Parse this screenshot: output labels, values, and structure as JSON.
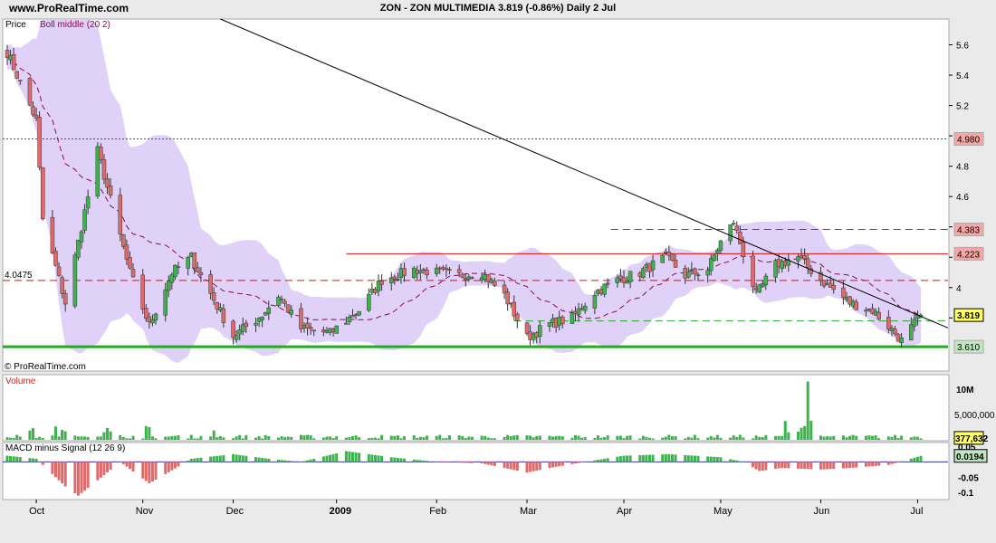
{
  "header": {
    "site": "www.ProRealTime.com",
    "title": "ZON - ZON MULTIMEDIA   3.819 (-0.86%)   Daily  2 Jul"
  },
  "colors": {
    "background": "#ffffff",
    "band": "#d9c9f7",
    "up": "#3cb44b",
    "down": "#e06a6a",
    "candle_outline": "#333333",
    "boll_middle": "#8b0a50",
    "support": "#22aa22",
    "resistance_red": "#dd1111"
  },
  "chart_data": [
    {
      "type": "candlestick",
      "panel": "price",
      "legend": [
        "Price",
        "Boll middle (20 2)"
      ],
      "y_ticks": [
        5.6,
        5.4,
        5.2,
        5,
        4.8,
        4.6,
        4.4,
        4.2,
        4,
        3.8
      ],
      "ylim": [
        3.45,
        5.77
      ],
      "x_ticks": [
        "Oct",
        "Nov",
        "Dec",
        "2009",
        "Feb",
        "Mar",
        "Apr",
        "May",
        "Jun",
        "Jul"
      ],
      "left_label": "4.0475",
      "price_labels": [
        "4.980",
        "4.383",
        "4.223",
        "3.819",
        "3.610"
      ],
      "horizontal_lines": [
        {
          "value": 4.98,
          "style": "dotted",
          "label": "4.980"
        },
        {
          "value": 4.383,
          "style": "dashed",
          "label": "4.383"
        },
        {
          "value": 4.223,
          "style": "solid",
          "label": "4.223"
        },
        {
          "value": 4.0475,
          "style": "dashed",
          "label": "4.0475"
        },
        {
          "value": 3.78,
          "style": "dashed-green",
          "label": ""
        },
        {
          "value": 3.61,
          "style": "solid-green",
          "label": "3.610"
        }
      ],
      "trendline": {
        "start": {
          "date": "Nov 27",
          "value": 5.77
        },
        "end": {
          "date": "Jul 2",
          "value": 3.77
        }
      },
      "key_points": [
        {
          "date": "Sep 22",
          "close": 5.55
        },
        {
          "date": "Oct 1",
          "close": 5.1
        },
        {
          "date": "Oct 3",
          "close": 4.45
        },
        {
          "date": "Oct 10",
          "close": 3.9
        },
        {
          "date": "Oct 20",
          "close": 4.9
        },
        {
          "date": "Oct 30",
          "close": 4.1
        },
        {
          "date": "Nov 5",
          "close": 3.75
        },
        {
          "date": "Nov 12",
          "close": 4.1
        },
        {
          "date": "Nov 18",
          "close": 4.2
        },
        {
          "date": "Nov 25",
          "close": 3.92
        },
        {
          "date": "Dec 1",
          "close": 3.68
        },
        {
          "date": "Dec 10",
          "close": 3.82
        },
        {
          "date": "Dec 15",
          "close": 3.95
        },
        {
          "date": "Dec 22",
          "close": 3.73
        },
        {
          "date": "Dec 31",
          "close": 3.7
        },
        {
          "date": "Jan 9",
          "close": 3.85
        },
        {
          "date": "Jan 16",
          "close": 4.05
        },
        {
          "date": "Jan 26",
          "close": 4.12
        },
        {
          "date": "Feb 2",
          "close": 4.1
        },
        {
          "date": "Feb 9",
          "close": 4.08
        },
        {
          "date": "Feb 16",
          "close": 4.1
        },
        {
          "date": "Feb 23",
          "close": 3.95
        },
        {
          "date": "Mar 2",
          "close": 3.67
        },
        {
          "date": "Mar 9",
          "close": 3.76
        },
        {
          "date": "Mar 16",
          "close": 3.8
        },
        {
          "date": "Mar 23",
          "close": 3.97
        },
        {
          "date": "Mar 30",
          "close": 4.05
        },
        {
          "date": "Apr 6",
          "close": 4.1
        },
        {
          "date": "Apr 14",
          "close": 4.2
        },
        {
          "date": "Apr 20",
          "close": 4.08
        },
        {
          "date": "Apr 27",
          "close": 4.12
        },
        {
          "date": "May 1",
          "close": 4.3
        },
        {
          "date": "May 5",
          "close": 4.43
        },
        {
          "date": "May 12",
          "close": 3.95
        },
        {
          "date": "May 18",
          "close": 4.15
        },
        {
          "date": "May 25",
          "close": 4.2
        },
        {
          "date": "Jun 1",
          "close": 4.05
        },
        {
          "date": "Jun 10",
          "close": 3.9
        },
        {
          "date": "Jun 17",
          "close": 3.85
        },
        {
          "date": "Jun 24",
          "close": 3.7
        },
        {
          "date": "Jun 26",
          "close": 3.65
        },
        {
          "date": "Jul 2",
          "close": 3.819
        }
      ]
    },
    {
      "type": "bar",
      "panel": "volume",
      "label": "Volume",
      "y_ticks": [
        "10M",
        "5,000,000"
      ],
      "current_label": "377,632",
      "peak": {
        "date": "May 28",
        "value": 11500000
      },
      "typical_value": 1000000
    },
    {
      "type": "bar",
      "panel": "macd",
      "label": "MACD minus Signal (12 26 9)",
      "y_ticks": [
        "0.05",
        "-0.05",
        "-0.1"
      ],
      "current_label": "0.0194",
      "ylim": [
        -0.12,
        0.06
      ],
      "x": [
        "Sep 22",
        "Oct 1",
        "Oct 10",
        "Oct 14",
        "Oct 20",
        "Oct 27",
        "Nov 5",
        "Nov 10",
        "Nov 18",
        "Dec 1",
        "Dec 12",
        "Dec 22",
        "Jan 5",
        "Jan 19",
        "Feb 2",
        "Feb 16",
        "Mar 2",
        "Mar 9",
        "Mar 20",
        "Apr 1",
        "Apr 15",
        "May 1",
        "May 8",
        "May 13",
        "May 20",
        "Jun 1",
        "Jun 10",
        "Jun 22",
        "Jul 2"
      ],
      "values": [
        0.02,
        0.01,
        -0.08,
        -0.11,
        -0.06,
        0.0,
        -0.07,
        -0.04,
        0.01,
        0.025,
        0.01,
        0.0,
        0.035,
        0.015,
        0.0,
        -0.005,
        -0.035,
        -0.02,
        0.0,
        0.02,
        0.025,
        0.015,
        0.0,
        -0.03,
        -0.02,
        -0.025,
        -0.02,
        -0.01,
        0.0194
      ]
    }
  ],
  "footer": {
    "copyright": "© ProRealTime.com"
  }
}
